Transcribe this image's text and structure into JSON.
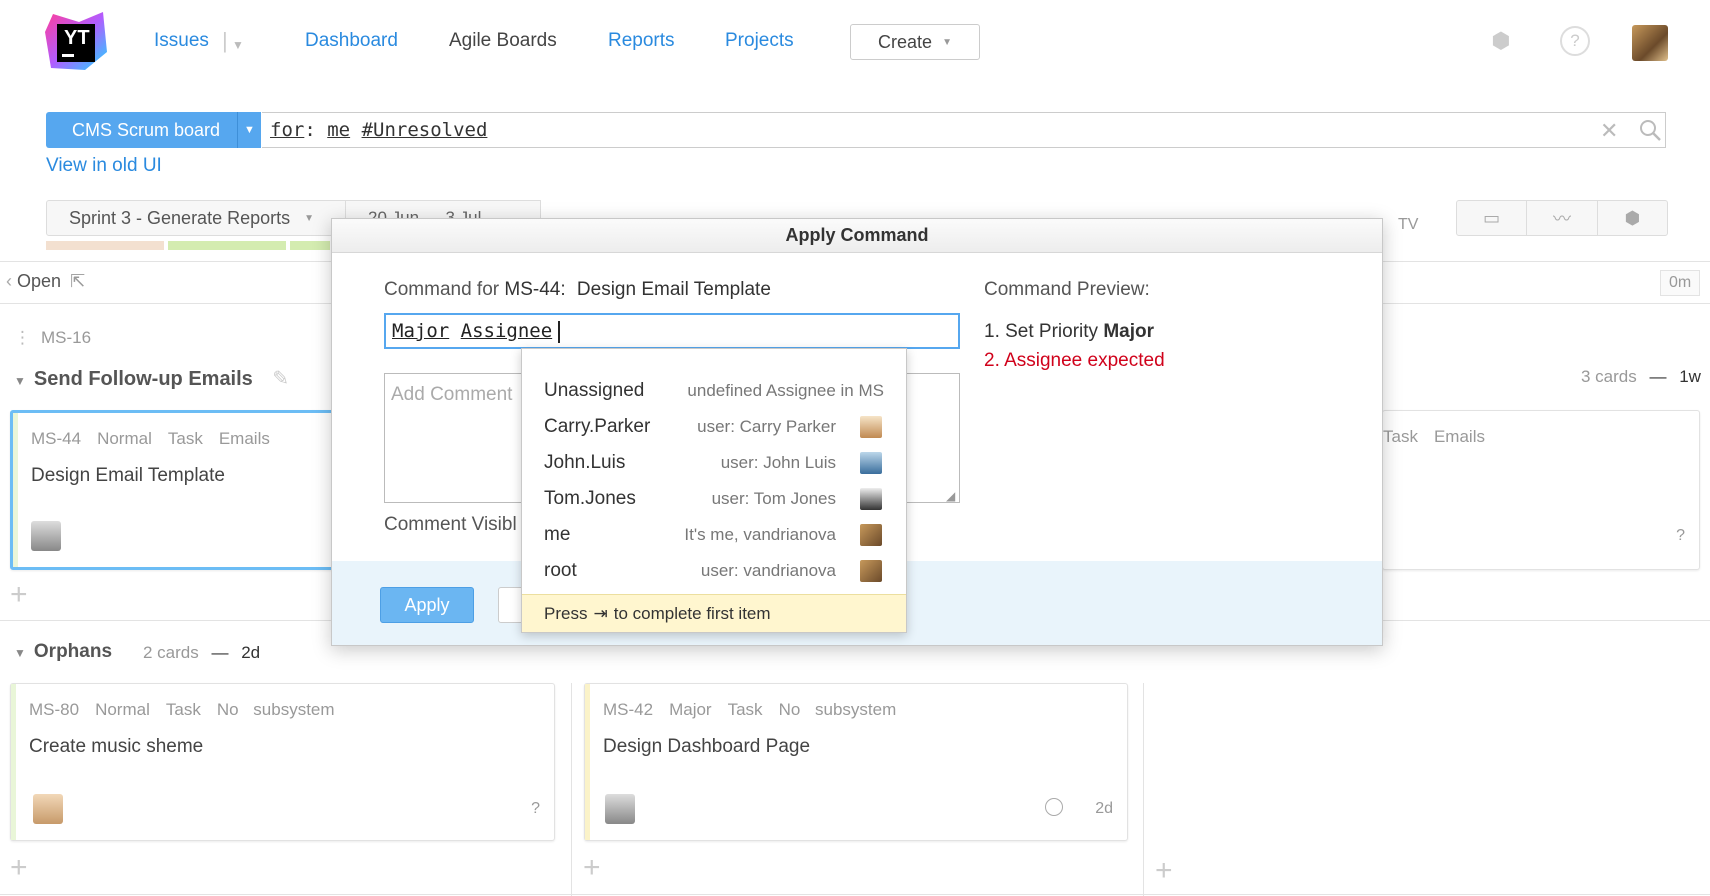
{
  "header": {
    "logo_text": "YT",
    "nav": {
      "issues": "Issues",
      "dashboard": "Dashboard",
      "agile_boards": "Agile Boards",
      "reports": "Reports",
      "projects": "Projects"
    },
    "create_label": "Create"
  },
  "search": {
    "board_label": "CMS Scrum board",
    "query_for": "for",
    "query_me": "me",
    "query_tag": "#Unresolved",
    "old_ui_link": "View in old UI"
  },
  "sprint": {
    "name": "Sprint 3 - Generate Reports",
    "dates": "20 Jun — 3 Jul",
    "tv_label": "TV"
  },
  "board": {
    "open_label": "Open",
    "zero_time": "0m",
    "parent_id": "MS-16",
    "swimlane_title": "Send Follow-up Emails",
    "swimlane_cards": "3 cards",
    "swimlane_dash": "—",
    "swimlane_time": "1w",
    "orphans_title": "Orphans",
    "orphans_cards": "2 cards",
    "orphans_dash": "—",
    "orphans_time": "2d",
    "cards": [
      {
        "id": "MS-44",
        "priority": "Normal",
        "type": "Task",
        "subsystem": "Emails",
        "title": "Design Email Template"
      },
      {
        "type": "Task",
        "subsystem": "Emails",
        "estimate": "?"
      },
      {
        "id": "MS-80",
        "priority": "Normal",
        "type": "Task",
        "subsystem": "No subsystem",
        "title": "Create music sheme",
        "estimate": "?"
      },
      {
        "id": "MS-42",
        "priority": "Major",
        "type": "Task",
        "subsystem": "No subsystem",
        "title": "Design Dashboard Page",
        "estimate": "2d"
      }
    ]
  },
  "dialog": {
    "title": "Apply Command",
    "command_for_prefix": "Command for",
    "issue_id": "MS-44:",
    "issue_title": "Design Email Template",
    "command_word1": "Major",
    "command_word2": "Assignee",
    "comment_placeholder": "Add Comment",
    "comment_visibility": "Comment Visibl",
    "apply_label": "Apply",
    "preview_title": "Command Preview:",
    "preview_1_prefix": "1. Set Priority",
    "preview_1_value": "Major",
    "preview_2": "2. Assignee expected",
    "colors": {
      "error": "#d0021b",
      "accent": "#56a7ef"
    }
  },
  "autocomplete": {
    "items": [
      {
        "name": "Unassigned",
        "desc": "undefined Assignee in MS"
      },
      {
        "name": "Carry.Parker",
        "desc": "user: Carry Parker"
      },
      {
        "name": "John.Luis",
        "desc": "user: John Luis"
      },
      {
        "name": "Tom.Jones",
        "desc": "user: Tom Jones"
      },
      {
        "name": "me",
        "desc": "It's me, vandrianova"
      },
      {
        "name": "root",
        "desc": "user: vandrianova"
      }
    ],
    "hint_prefix": "Press",
    "hint_key": "⇥",
    "hint_suffix": "to complete first item"
  }
}
